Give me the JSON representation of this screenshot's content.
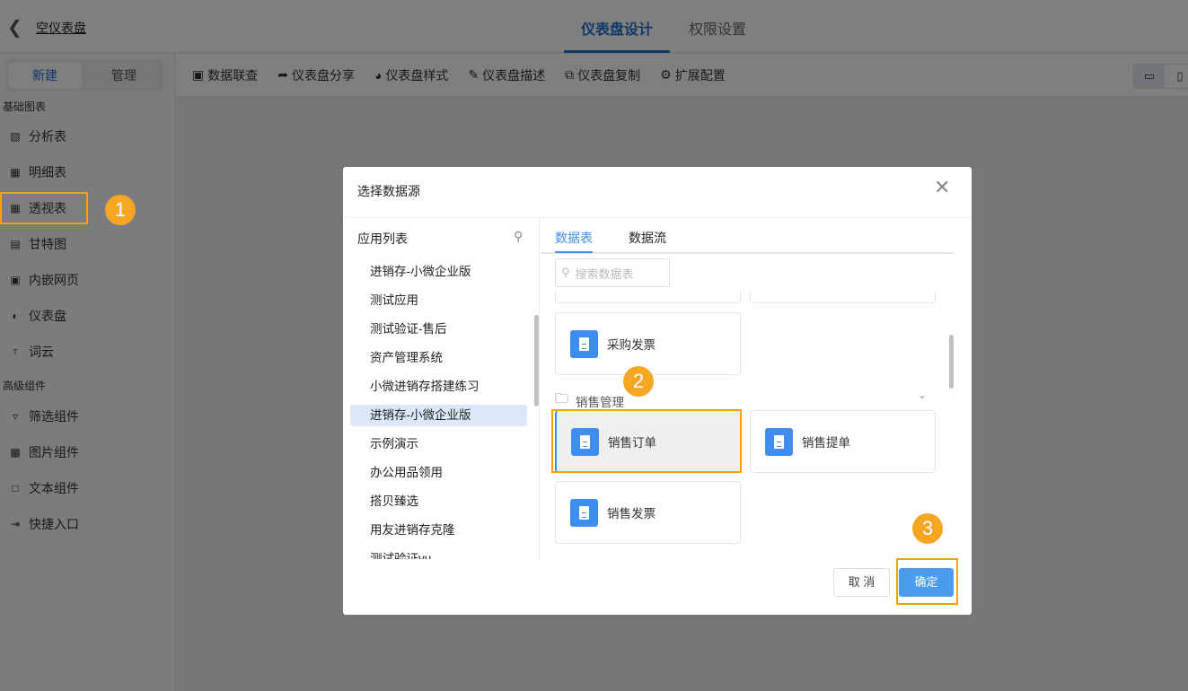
{
  "header": {
    "title": "空仪表盘",
    "tabs": [
      "仪表盘设计",
      "权限设置"
    ]
  },
  "sidebar": {
    "toggle": [
      "新建",
      "管理"
    ],
    "sections": [
      {
        "label": "基础图表",
        "items": [
          "分析表",
          "明细表",
          "透视表",
          "甘特图",
          "内嵌网页",
          "仪表盘",
          "词云"
        ]
      },
      {
        "label": "高级组件",
        "items": [
          "筛选组件",
          "图片组件",
          "文本组件",
          "快捷入口"
        ]
      }
    ]
  },
  "toolbar": {
    "items": [
      "数据联查",
      "仪表盘分享",
      "仪表盘样式",
      "仪表盘描述",
      "仪表盘复制",
      "扩展配置"
    ]
  },
  "dialog": {
    "title": "选择数据源",
    "left_header": "应用列表",
    "apps": [
      "进销存-小微企业版",
      "测试应用",
      "测试验证-售后",
      "资产管理系统",
      "小微进销存搭建练习",
      "进销存-小微企业版",
      "示例演示",
      "办公用品领用",
      "搭贝臻选",
      "用友进销存克隆",
      "测试验证vu"
    ],
    "selected_app_index": 5,
    "tabs": [
      "数据表",
      "数据流"
    ],
    "search_placeholder": "搜索数据表",
    "cards_top": [
      "采购发票"
    ],
    "folder": "销售管理",
    "cards": [
      "销售订单",
      "销售提单",
      "销售发票"
    ],
    "cancel": "取 消",
    "ok": "确定"
  },
  "annotations": [
    "1",
    "2",
    "3"
  ],
  "colors": {
    "accent": "#1f6fd1",
    "highlight": "#f5a20c",
    "badge": "#f5a623"
  }
}
